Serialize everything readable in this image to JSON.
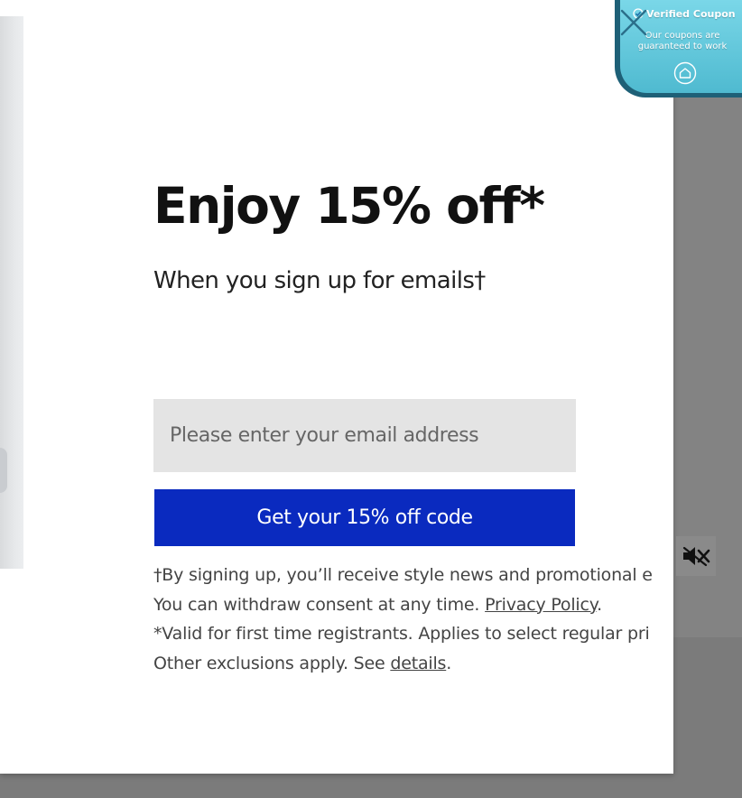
{
  "modal": {
    "headline": "Enjoy 15% off*",
    "subheadline": "When you sign up for emails†",
    "email_placeholder": "Please enter your email address",
    "cta_label": "Get your 15% off code",
    "legal": {
      "line1": "†By signing up, you’ll receive style news and promotional e",
      "line2_prefix": "You can withdraw consent at any time. ",
      "privacy_link": "Privacy Policy",
      "line2_suffix": ".",
      "line3": "*Valid for first time registrants. Applies to select regular pri",
      "line4_prefix": "Other exclusions apply. See ",
      "details_link": "details",
      "line4_suffix": "."
    }
  },
  "coupon_badge": {
    "title": "Verified Coupon",
    "text": "Our coupons are guaranteed to work",
    "icons": [
      "check-icon",
      "home-icon",
      "close-icon"
    ]
  },
  "mute_button": {
    "icon": "speaker-muted-icon"
  },
  "colors": {
    "cta_background": "#0a2abf",
    "input_background": "#e4e4e4",
    "backdrop": "#7b7b7b",
    "coupon_gradient_top": "#7ad7e8",
    "coupon_gradient_bottom": "#4fbad0"
  }
}
